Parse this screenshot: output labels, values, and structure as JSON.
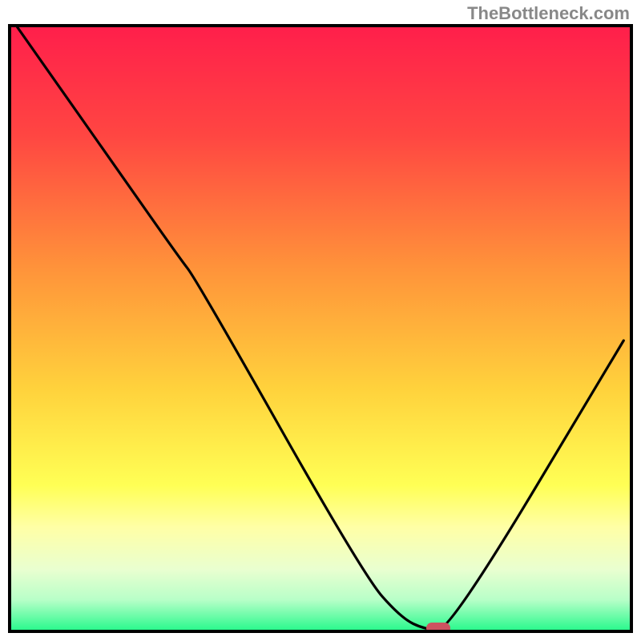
{
  "watermark": "TheBottleneck.com",
  "gradient": {
    "stops": [
      {
        "offset": 0.0,
        "color": "#ff1f4b"
      },
      {
        "offset": 0.18,
        "color": "#ff4642"
      },
      {
        "offset": 0.4,
        "color": "#ff933a"
      },
      {
        "offset": 0.6,
        "color": "#ffd23c"
      },
      {
        "offset": 0.76,
        "color": "#ffff55"
      },
      {
        "offset": 0.83,
        "color": "#ffffa6"
      },
      {
        "offset": 0.9,
        "color": "#e9ffd0"
      },
      {
        "offset": 0.95,
        "color": "#b8ffc8"
      },
      {
        "offset": 1.0,
        "color": "#2cf98e"
      }
    ]
  },
  "chart_data": {
    "type": "line",
    "title": "",
    "xlabel": "",
    "ylabel": "",
    "xlim": [
      0,
      100
    ],
    "ylim": [
      0,
      100
    ],
    "grid": false,
    "legend": false,
    "series": [
      {
        "name": "curve",
        "x": [
          1,
          14,
          27,
          30,
          57,
          63,
          67,
          71,
          99
        ],
        "y": [
          100,
          81,
          62,
          58,
          9,
          2,
          0,
          0,
          48
        ]
      }
    ],
    "marker": {
      "x": 69,
      "y": 0,
      "color": "#cd5360"
    },
    "background_gradient_direction": "top-to-bottom"
  }
}
